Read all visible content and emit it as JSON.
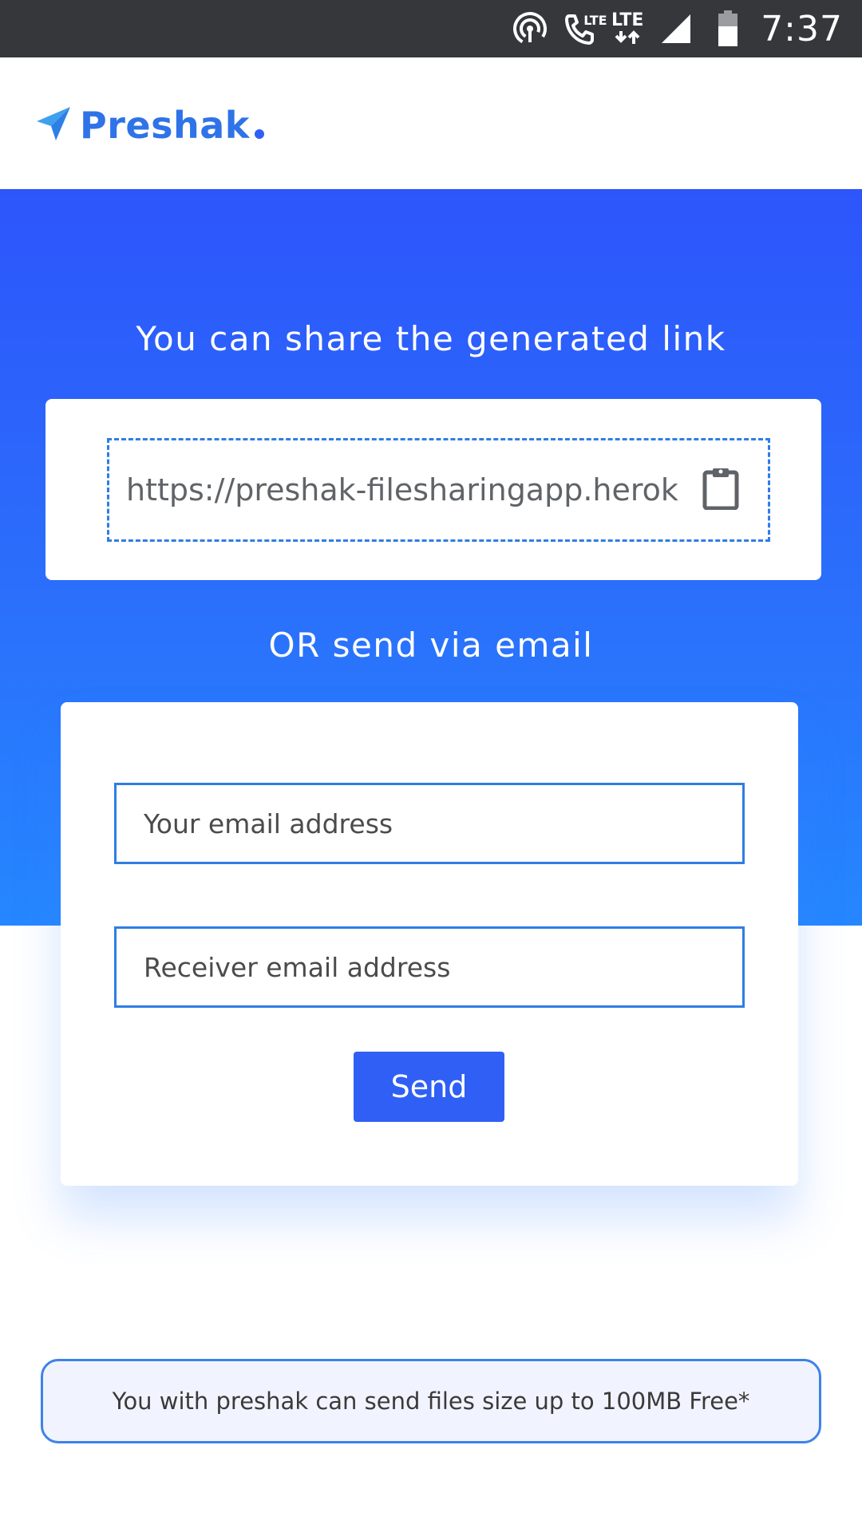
{
  "status_bar": {
    "time": "7:37",
    "lte1": "LTE",
    "lte2": "LTE",
    "icons": [
      "hotspot-icon",
      "volte-call-icon",
      "lte-data-icon",
      "signal-icon",
      "battery-icon"
    ]
  },
  "header": {
    "brand": "Preshak",
    "logo_icon": "paper-plane-icon",
    "brand_color": "#2f73e8"
  },
  "hero": {
    "title": "You can share the generated link",
    "link_value": "https://preshak-filesharingapp.herok",
    "copy_icon": "clipboard-icon",
    "or_text": "OR send via email",
    "gradient_top": "#2d55fb",
    "gradient_bottom": "#2587ff"
  },
  "email_form": {
    "sender_placeholder": "Your email address",
    "receiver_placeholder": "Receiver email address",
    "send_label": "Send",
    "button_color": "#2f5ff5"
  },
  "footer": {
    "note": "You with preshak can send files size up to 100MB Free*"
  }
}
